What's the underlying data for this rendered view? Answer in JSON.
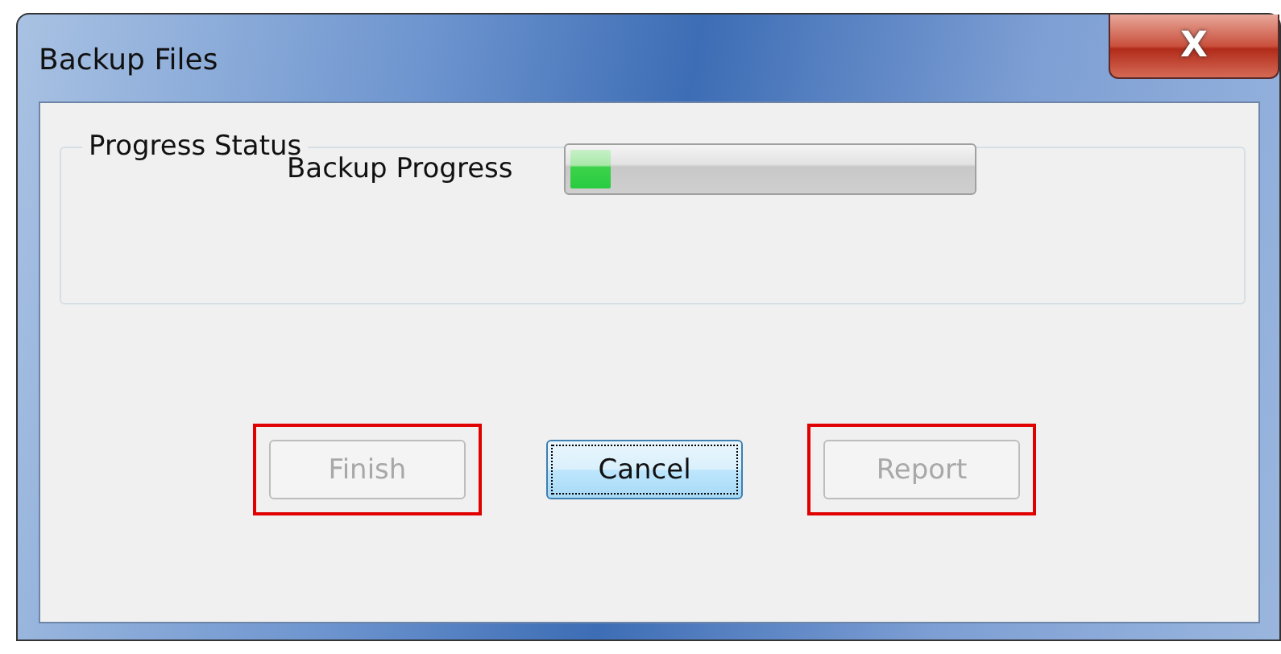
{
  "window": {
    "title": "Backup Files",
    "close_glyph": "X"
  },
  "group": {
    "title": "Progress Status",
    "progress": {
      "label": "Backup Progress",
      "level": 0.1
    }
  },
  "buttons": [
    {
      "label": "Finish",
      "disabled": true,
      "focused": false,
      "highlighted": true
    },
    {
      "label": "Cancel",
      "disabled": false,
      "focused": true,
      "highlighted": false
    },
    {
      "label": "Report",
      "disabled": true,
      "focused": false,
      "highlighted": true
    }
  ]
}
